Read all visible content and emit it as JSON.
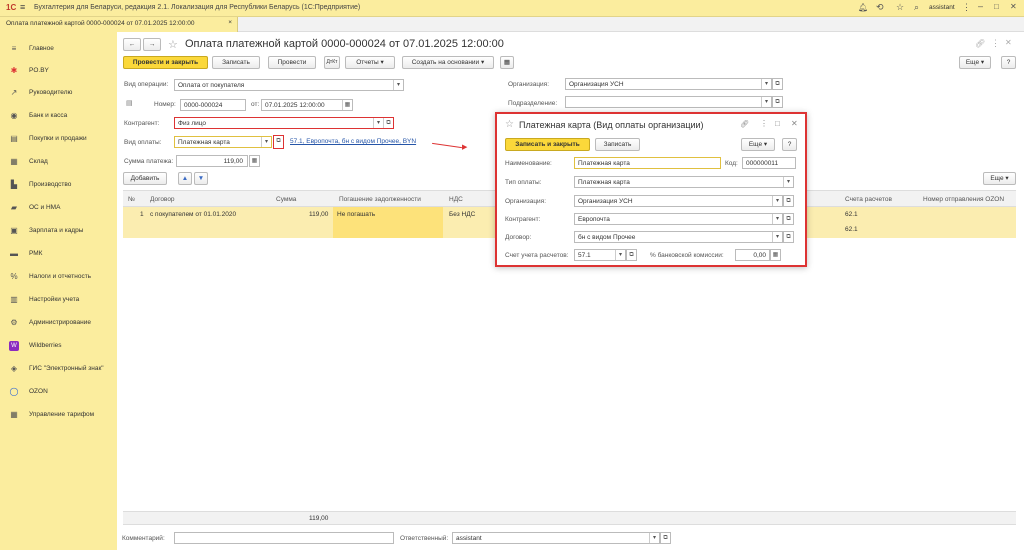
{
  "titlebar": {
    "app_title": "Бухгалтерия для Беларуси, редакция 2.1. Локализация для Республики Беларусь  (1С:Предприятие)",
    "user": "assistant"
  },
  "tab": {
    "label": "Оплата платежной картой 0000-000024 от 07.01.2025 12:00:00"
  },
  "sidebar": {
    "items": [
      {
        "label": "Главное",
        "icon": "≡"
      },
      {
        "label": "PO.BY",
        "icon": "✱"
      },
      {
        "label": "Руководителю",
        "icon": "↗"
      },
      {
        "label": "Банк и касса",
        "icon": "◉"
      },
      {
        "label": "Покупки и продажи",
        "icon": "▤"
      },
      {
        "label": "Склад",
        "icon": "▦"
      },
      {
        "label": "Производство",
        "icon": "▙"
      },
      {
        "label": "ОС и НМА",
        "icon": "▰"
      },
      {
        "label": "Зарплата и кадры",
        "icon": "▣"
      },
      {
        "label": "РМК",
        "icon": "▬"
      },
      {
        "label": "Налоги и отчетность",
        "icon": "%"
      },
      {
        "label": "Настройки учета",
        "icon": "▥"
      },
      {
        "label": "Администрирование",
        "icon": "⚙"
      },
      {
        "label": "Wildberries",
        "icon": "W"
      },
      {
        "label": "ГИС \"Электронный знак\"",
        "icon": "◈"
      },
      {
        "label": "OZON",
        "icon": "◯"
      },
      {
        "label": "Управление тарифом",
        "icon": "▦"
      }
    ]
  },
  "doc": {
    "title": "Оплата платежной картой 0000-000024 от 07.01.2025 12:00:00",
    "toolbar": {
      "post_close": "Провести и закрыть",
      "save": "Записать",
      "post": "Провести",
      "reports": "Отчеты",
      "create_base": "Создать на основании",
      "more": "Еще",
      "help": "?"
    },
    "op_type_label": "Вид операции:",
    "op_type_value": "Оплата от покупателя",
    "number_label": "Номер:",
    "number_value": "0000-000024",
    "from_label": "от:",
    "date_value": "07.01.2025 12:00:00",
    "org_label": "Организация:",
    "org_value": "Организация УСН",
    "division_label": "Подразделение:",
    "division_value": "",
    "counterparty_label": "Контрагент:",
    "counterparty_value": "Физ лицо",
    "pay_type_label": "Вид оплаты:",
    "pay_type_value": "Платежная карта",
    "pay_link": "57.1, Европочта, бн с видом Прочее, BYN",
    "amount_label": "Сумма платежа:",
    "amount_value": "119,00",
    "add_btn": "Добавить",
    "more2": "Еще",
    "comment_label": "Комментарий:",
    "comment_value": "",
    "responsible_label": "Ответственный:",
    "responsible_value": "assistant"
  },
  "table": {
    "headers": [
      "№",
      "Договор",
      "Сумма",
      "Погашение задолженности",
      "НДС",
      "Счета расчетов",
      "Номер отправления OZON"
    ],
    "row": {
      "n": "1",
      "contract": "с покупателем от 01.01.2020",
      "sum": "119,00",
      "repay": "Не погашать",
      "vat": "Без НДС",
      "acc1": "62.1",
      "acc2": "62.1"
    },
    "total": "119,00"
  },
  "dialog": {
    "title": "Платежная карта (Вид оплаты организации)",
    "save_close": "Записать и закрыть",
    "save": "Записать",
    "more": "Еще",
    "help": "?",
    "name_label": "Наименование:",
    "name_value": "Платежная карта",
    "code_label": "Код:",
    "code_value": "000000011",
    "paytype_label": "Тип оплаты:",
    "paytype_value": "Платежная карта",
    "org_label": "Организация:",
    "org_value": "Организация УСН",
    "cp_label": "Контрагент:",
    "cp_value": "Европочта",
    "contract_label": "Договор:",
    "contract_value": "бн с видом Прочее",
    "acc_label": "Счет учета расчетов:",
    "acc_value": "57.1",
    "commission_label": "% банковской комиссии:",
    "commission_value": "0,00"
  },
  "colors": {
    "accent": "#fbd83a",
    "panel": "#fbed9e",
    "highlight": "#d33333",
    "link": "#2555a8"
  }
}
